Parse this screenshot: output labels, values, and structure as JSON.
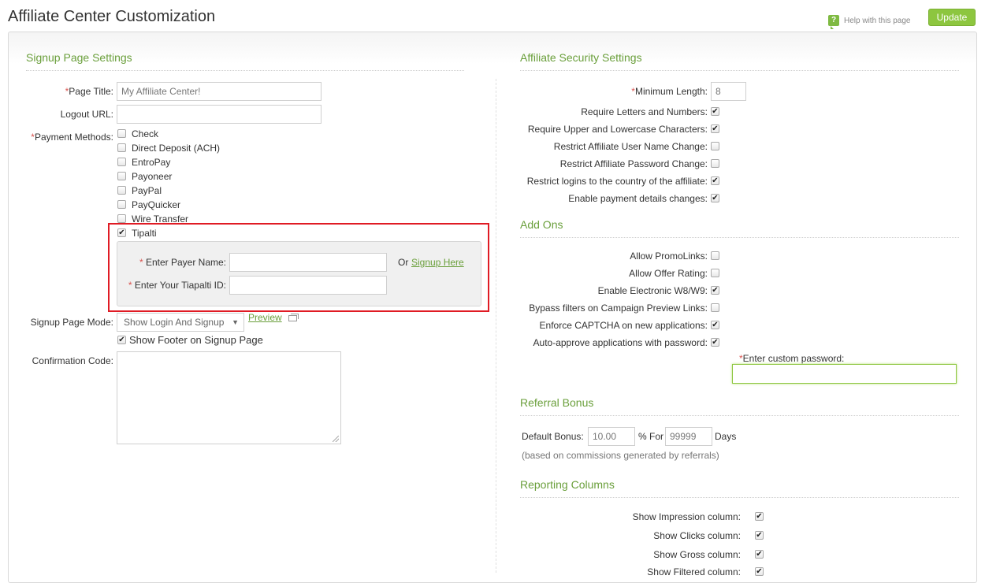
{
  "header": {
    "title": "Affiliate Center Customization",
    "help_label": "Help with this page",
    "help_icon": "question-speech-icon",
    "update_label": "Update",
    "accent_color": "#8dc63f"
  },
  "signup": {
    "title": "Signup Page Settings",
    "page_title_label": "Page Title:",
    "page_title_value": "My Affiliate Center!",
    "logout_url_label": "Logout URL:",
    "logout_url_value": "",
    "payment_methods_label": "Payment Methods:",
    "payment_methods": [
      {
        "label": "Check",
        "checked": false
      },
      {
        "label": "Direct Deposit (ACH)",
        "checked": false
      },
      {
        "label": "EntroPay",
        "checked": false
      },
      {
        "label": "Payoneer",
        "checked": false
      },
      {
        "label": "PayPal",
        "checked": false
      },
      {
        "label": "PayQuicker",
        "checked": false
      },
      {
        "label": "Wire Transfer",
        "checked": false
      },
      {
        "label": "Tipalti",
        "checked": true
      }
    ],
    "tipalti": {
      "payer_name_label": "Enter Payer Name:",
      "payer_name_value": "",
      "tipalti_id_label": "Enter Your Tiapalti ID:",
      "tipalti_id_value": "",
      "or_text": "Or",
      "signup_link": "Signup Here"
    },
    "signup_mode_label": "Signup Page Mode:",
    "signup_mode_value": "Show Login And Signup",
    "preview_link": "Preview",
    "show_footer_label": "Show Footer on Signup Page",
    "show_footer_checked": true,
    "confirmation_code_label": "Confirmation Code:",
    "confirmation_code_value": ""
  },
  "security": {
    "title": "Affiliate Security Settings",
    "min_length_label": "Minimum Length:",
    "min_length_value": "8",
    "options": [
      {
        "label": "Require Letters and Numbers:",
        "checked": true
      },
      {
        "label": "Require Upper and Lowercase Characters:",
        "checked": true
      },
      {
        "label": "Restrict Affiliate User Name Change:",
        "checked": false
      },
      {
        "label": "Restrict Affiliate Password Change:",
        "checked": false
      },
      {
        "label": "Restrict logins to the country of the affiliate:",
        "checked": true
      },
      {
        "label": "Enable payment details changes:",
        "checked": true
      }
    ]
  },
  "addons": {
    "title": "Add Ons",
    "options": [
      {
        "label": "Allow PromoLinks:",
        "checked": false
      },
      {
        "label": "Allow Offer Rating:",
        "checked": false
      },
      {
        "label": "Enable Electronic W8/W9:",
        "checked": true
      },
      {
        "label": "Bypass filters on Campaign Preview Links:",
        "checked": false
      },
      {
        "label": "Enforce CAPTCHA on new applications:",
        "checked": true
      },
      {
        "label": "Auto-approve applications with password:",
        "checked": true
      }
    ],
    "custom_password_label": "Enter custom password:",
    "custom_password_value": ""
  },
  "referral": {
    "title": "Referral Bonus",
    "default_bonus_label": "Default Bonus:",
    "default_bonus_value": "10.00",
    "percent_for_label": "% For",
    "days_value": "99999",
    "days_label": "Days",
    "note": "(based on commissions generated by referrals)"
  },
  "reporting": {
    "title": "Reporting Columns",
    "options": [
      {
        "label": "Show Impression column:",
        "checked": true
      },
      {
        "label": "Show Clicks column:",
        "checked": true
      },
      {
        "label": "Show Gross column:",
        "checked": true
      },
      {
        "label": "Show Filtered column:",
        "checked": true
      }
    ]
  }
}
